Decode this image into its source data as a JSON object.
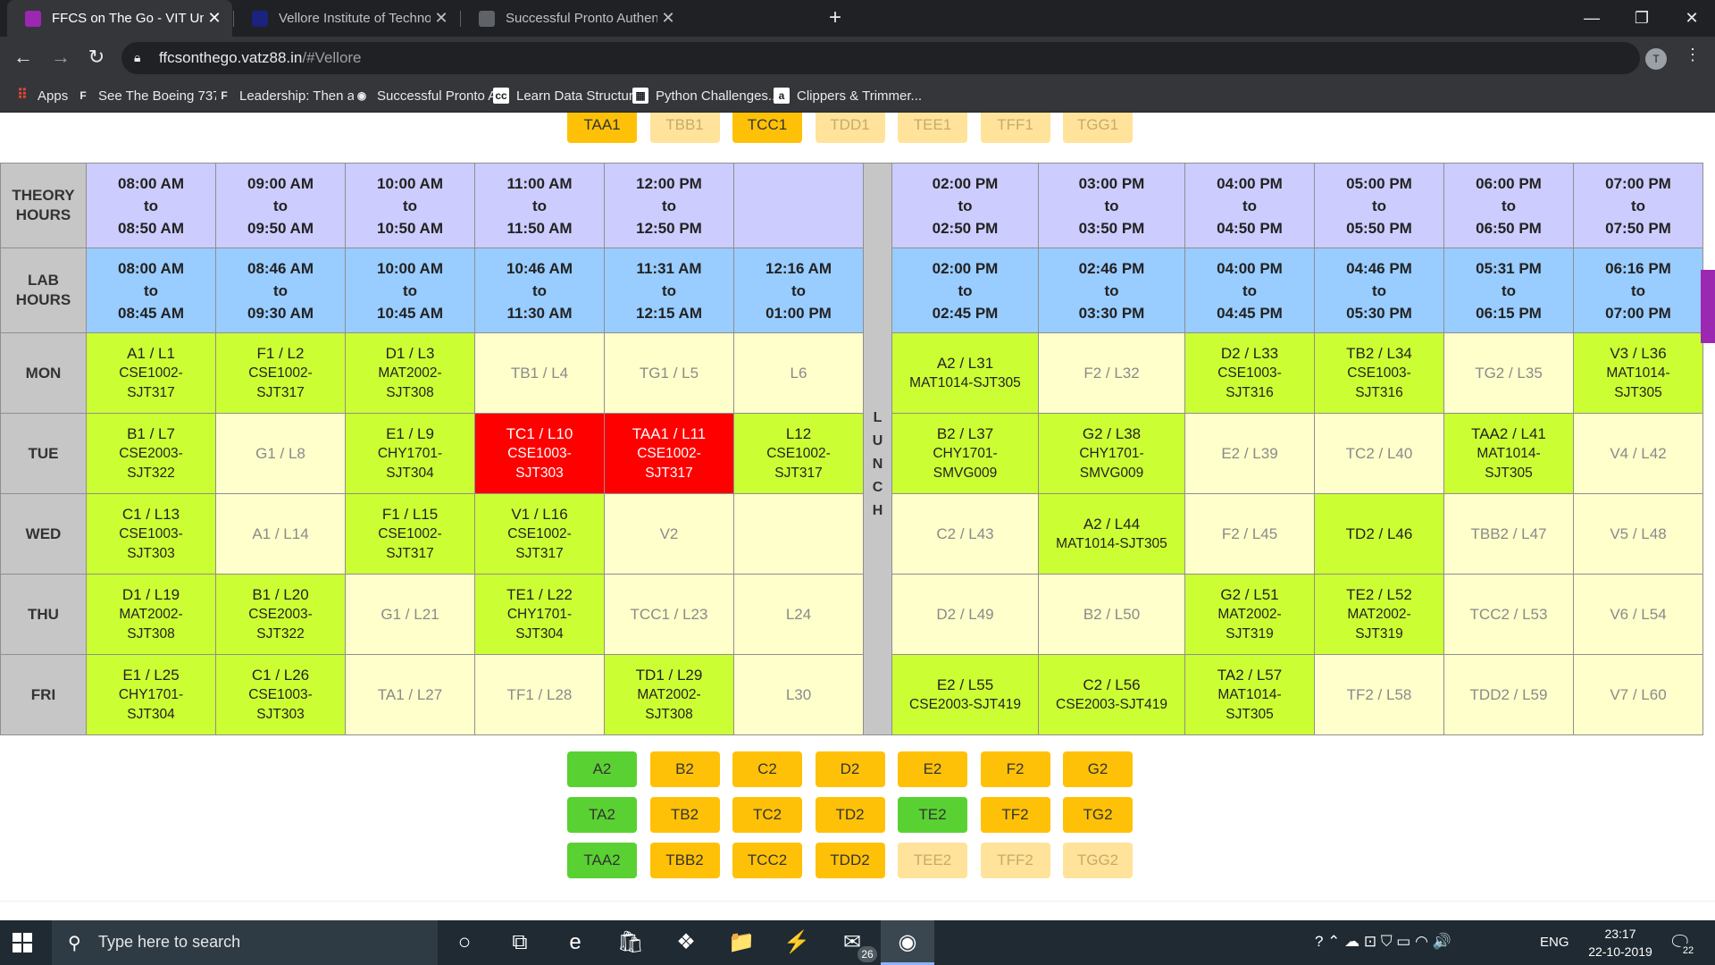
{
  "browser": {
    "tabs": [
      {
        "title": "FFCS on The Go - VIT University",
        "active": true,
        "favicon_color": "#9c27b0"
      },
      {
        "title": "Vellore Institute of Technology (V",
        "active": false,
        "favicon_color": "#1a237e"
      },
      {
        "title": "Successful Pronto Authentication",
        "active": false,
        "favicon_color": "#5f6368"
      }
    ],
    "close_glyph": "✕",
    "new_tab_glyph": "+",
    "window_controls": {
      "minimize": "—",
      "restore": "❐",
      "close": "✕"
    },
    "nav": {
      "back": "←",
      "forward": "→",
      "reload": "↻"
    },
    "url_host": "ffcsonthego.vatz88.in",
    "url_path": "/#Vellore",
    "profile_initial": "T",
    "bookmarks": [
      {
        "label": "Apps",
        "icon": "apps-grid-icon",
        "icon_text": "⠿",
        "color": "#ea4335"
      },
      {
        "label": "See The Boeing 737...",
        "icon": "f-icon",
        "icon_text": "F",
        "color": "#35363a"
      },
      {
        "label": "Leadership: Then a...",
        "icon": "f-icon",
        "icon_text": "F",
        "color": "#35363a"
      },
      {
        "label": "Successful Pronto A...",
        "icon": "globe-icon",
        "icon_text": "◉",
        "color": "#35363a"
      },
      {
        "label": "Learn Data Structur...",
        "icon": "cc-icon",
        "icon_text": "cc",
        "color": "#ffffff"
      },
      {
        "label": "Python Challenges...",
        "icon": "python-challenges-icon",
        "icon_text": "▦",
        "color": "#ffffff"
      },
      {
        "label": "Clippers & Trimmer...",
        "icon": "amazon-icon",
        "icon_text": "a",
        "color": "#ffffff"
      }
    ]
  },
  "top_slots": [
    {
      "label": "TAA1",
      "state": "orange"
    },
    {
      "label": "TBB1",
      "state": "pale"
    },
    {
      "label": "TCC1",
      "state": "orange"
    },
    {
      "label": "TDD1",
      "state": "pale"
    },
    {
      "label": "TEE1",
      "state": "pale"
    },
    {
      "label": "TFF1",
      "state": "pale"
    },
    {
      "label": "TGG1",
      "state": "pale"
    }
  ],
  "timetable": {
    "theory_label": [
      "THEORY",
      "HOURS"
    ],
    "lab_label": [
      "LAB",
      "HOURS"
    ],
    "lunch_letters": [
      "L",
      "U",
      "N",
      "C",
      "H"
    ],
    "to_word": "to",
    "theory_hours": [
      [
        "08:00 AM",
        "08:50 AM"
      ],
      [
        "09:00 AM",
        "09:50 AM"
      ],
      [
        "10:00 AM",
        "10:50 AM"
      ],
      [
        "11:00 AM",
        "11:50 AM"
      ],
      [
        "12:00 PM",
        "12:50 PM"
      ],
      null,
      [
        "02:00 PM",
        "02:50 PM"
      ],
      [
        "03:00 PM",
        "03:50 PM"
      ],
      [
        "04:00 PM",
        "04:50 PM"
      ],
      [
        "05:00 PM",
        "05:50 PM"
      ],
      [
        "06:00 PM",
        "06:50 PM"
      ],
      [
        "07:00 PM",
        "07:50 PM"
      ]
    ],
    "lab_hours": [
      [
        "08:00 AM",
        "08:45 AM"
      ],
      [
        "08:46 AM",
        "09:30 AM"
      ],
      [
        "10:00 AM",
        "10:45 AM"
      ],
      [
        "10:46 AM",
        "11:30 AM"
      ],
      [
        "11:31 AM",
        "12:15 AM"
      ],
      [
        "12:16 AM",
        "01:00 PM"
      ],
      [
        "02:00 PM",
        "02:45 PM"
      ],
      [
        "02:46 PM",
        "03:30 PM"
      ],
      [
        "04:00 PM",
        "04:45 PM"
      ],
      [
        "04:46 PM",
        "05:30 PM"
      ],
      [
        "05:31 PM",
        "06:15 PM"
      ],
      [
        "06:16 PM",
        "07:00 PM"
      ]
    ],
    "days": [
      {
        "day": "MON",
        "cells": [
          {
            "label": "A1 / L1",
            "sub": [
              "CSE1002-",
              "SJT317"
            ],
            "state": "green"
          },
          {
            "label": "F1 / L2",
            "sub": [
              "CSE1002-",
              "SJT317"
            ],
            "state": "green"
          },
          {
            "label": "D1 / L3",
            "sub": [
              "MAT2002-",
              "SJT308"
            ],
            "state": "green"
          },
          {
            "label": "TB1 / L4",
            "sub": [],
            "state": "pale"
          },
          {
            "label": "TG1 / L5",
            "sub": [],
            "state": "pale"
          },
          {
            "label": "L6",
            "sub": [],
            "state": "pale"
          },
          {
            "label": "A2 / L31",
            "sub": [
              "MAT1014-SJT305"
            ],
            "state": "green"
          },
          {
            "label": "F2 / L32",
            "sub": [],
            "state": "pale"
          },
          {
            "label": "D2 / L33",
            "sub": [
              "CSE1003-",
              "SJT316"
            ],
            "state": "green"
          },
          {
            "label": "TB2 / L34",
            "sub": [
              "CSE1003-",
              "SJT316"
            ],
            "state": "green"
          },
          {
            "label": "TG2 / L35",
            "sub": [],
            "state": "pale"
          },
          {
            "label": "V3 / L36",
            "sub": [
              "MAT1014-",
              "SJT305"
            ],
            "state": "green"
          }
        ]
      },
      {
        "day": "TUE",
        "cells": [
          {
            "label": "B1 / L7",
            "sub": [
              "CSE2003-",
              "SJT322"
            ],
            "state": "green"
          },
          {
            "label": "G1 / L8",
            "sub": [],
            "state": "pale"
          },
          {
            "label": "E1 / L9",
            "sub": [
              "CHY1701-",
              "SJT304"
            ],
            "state": "green"
          },
          {
            "label": "TC1 / L10",
            "sub": [
              "CSE1003-",
              "SJT303"
            ],
            "state": "red"
          },
          {
            "label": "TAA1 / L11",
            "sub": [
              "CSE1002-",
              "SJT317"
            ],
            "state": "red"
          },
          {
            "label": "L12",
            "sub": [
              "CSE1002-",
              "SJT317"
            ],
            "state": "green"
          },
          {
            "label": "B2 / L37",
            "sub": [
              "CHY1701-",
              "SMVG009"
            ],
            "state": "green"
          },
          {
            "label": "G2 / L38",
            "sub": [
              "CHY1701-",
              "SMVG009"
            ],
            "state": "green"
          },
          {
            "label": "E2 / L39",
            "sub": [],
            "state": "pale"
          },
          {
            "label": "TC2 / L40",
            "sub": [],
            "state": "pale"
          },
          {
            "label": "TAA2 / L41",
            "sub": [
              "MAT1014-",
              "SJT305"
            ],
            "state": "green"
          },
          {
            "label": "V4 / L42",
            "sub": [],
            "state": "pale"
          }
        ]
      },
      {
        "day": "WED",
        "cells": [
          {
            "label": "C1 / L13",
            "sub": [
              "CSE1003-",
              "SJT303"
            ],
            "state": "green"
          },
          {
            "label": "A1 / L14",
            "sub": [],
            "state": "pale"
          },
          {
            "label": "F1 / L15",
            "sub": [
              "CSE1002-",
              "SJT317"
            ],
            "state": "green"
          },
          {
            "label": "V1 / L16",
            "sub": [
              "CSE1002-",
              "SJT317"
            ],
            "state": "green"
          },
          {
            "label": "V2",
            "sub": [],
            "state": "pale"
          },
          {
            "label": "",
            "sub": [],
            "state": "pale"
          },
          {
            "label": "C2 / L43",
            "sub": [],
            "state": "pale"
          },
          {
            "label": "A2 / L44",
            "sub": [
              "MAT1014-SJT305"
            ],
            "state": "green"
          },
          {
            "label": "F2 / L45",
            "sub": [],
            "state": "pale"
          },
          {
            "label": "TD2 / L46",
            "sub": [],
            "state": "green"
          },
          {
            "label": "TBB2 / L47",
            "sub": [],
            "state": "pale"
          },
          {
            "label": "V5 / L48",
            "sub": [],
            "state": "pale"
          }
        ]
      },
      {
        "day": "THU",
        "cells": [
          {
            "label": "D1 / L19",
            "sub": [
              "MAT2002-",
              "SJT308"
            ],
            "state": "green"
          },
          {
            "label": "B1 / L20",
            "sub": [
              "CSE2003-",
              "SJT322"
            ],
            "state": "green"
          },
          {
            "label": "G1 / L21",
            "sub": [],
            "state": "pale"
          },
          {
            "label": "TE1 / L22",
            "sub": [
              "CHY1701-",
              "SJT304"
            ],
            "state": "green"
          },
          {
            "label": "TCC1 / L23",
            "sub": [],
            "state": "pale"
          },
          {
            "label": "L24",
            "sub": [],
            "state": "pale"
          },
          {
            "label": "D2 / L49",
            "sub": [],
            "state": "pale"
          },
          {
            "label": "B2 / L50",
            "sub": [],
            "state": "pale"
          },
          {
            "label": "G2 / L51",
            "sub": [
              "MAT2002-",
              "SJT319"
            ],
            "state": "green"
          },
          {
            "label": "TE2 / L52",
            "sub": [
              "MAT2002-",
              "SJT319"
            ],
            "state": "green"
          },
          {
            "label": "TCC2 / L53",
            "sub": [],
            "state": "pale"
          },
          {
            "label": "V6 / L54",
            "sub": [],
            "state": "pale"
          }
        ]
      },
      {
        "day": "FRI",
        "cells": [
          {
            "label": "E1 / L25",
            "sub": [
              "CHY1701-",
              "SJT304"
            ],
            "state": "green"
          },
          {
            "label": "C1 / L26",
            "sub": [
              "CSE1003-",
              "SJT303"
            ],
            "state": "green"
          },
          {
            "label": "TA1 / L27",
            "sub": [],
            "state": "pale"
          },
          {
            "label": "TF1 / L28",
            "sub": [],
            "state": "pale"
          },
          {
            "label": "TD1 / L29",
            "sub": [
              "MAT2002-",
              "SJT308"
            ],
            "state": "green"
          },
          {
            "label": "L30",
            "sub": [],
            "state": "pale"
          },
          {
            "label": "E2 / L55",
            "sub": [
              "CSE2003-SJT419"
            ],
            "state": "green"
          },
          {
            "label": "C2 / L56",
            "sub": [
              "CSE2003-SJT419"
            ],
            "state": "green"
          },
          {
            "label": "TA2 / L57",
            "sub": [
              "MAT1014-",
              "SJT305"
            ],
            "state": "green"
          },
          {
            "label": "TF2 / L58",
            "sub": [],
            "state": "pale"
          },
          {
            "label": "TDD2 / L59",
            "sub": [],
            "state": "pale"
          },
          {
            "label": "V7 / L60",
            "sub": [],
            "state": "pale"
          }
        ]
      }
    ]
  },
  "bottom_slots": [
    [
      {
        "label": "A2",
        "state": "green"
      },
      {
        "label": "B2",
        "state": "orange"
      },
      {
        "label": "C2",
        "state": "orange"
      },
      {
        "label": "D2",
        "state": "orange"
      },
      {
        "label": "E2",
        "state": "orange"
      },
      {
        "label": "F2",
        "state": "orange"
      },
      {
        "label": "G2",
        "state": "orange"
      }
    ],
    [
      {
        "label": "TA2",
        "state": "green"
      },
      {
        "label": "TB2",
        "state": "orange"
      },
      {
        "label": "TC2",
        "state": "orange"
      },
      {
        "label": "TD2",
        "state": "orange"
      },
      {
        "label": "TE2",
        "state": "green"
      },
      {
        "label": "TF2",
        "state": "orange"
      },
      {
        "label": "TG2",
        "state": "orange"
      }
    ],
    [
      {
        "label": "TAA2",
        "state": "green"
      },
      {
        "label": "TBB2",
        "state": "orange"
      },
      {
        "label": "TCC2",
        "state": "orange"
      },
      {
        "label": "TDD2",
        "state": "orange"
      },
      {
        "label": "TEE2",
        "state": "pale"
      },
      {
        "label": "TFF2",
        "state": "pale"
      },
      {
        "label": "TGG2",
        "state": "pale"
      }
    ]
  ],
  "taskbar": {
    "search_placeholder": "Type here to search",
    "search_glyph": "⚲",
    "apps": [
      {
        "name": "cortana-icon",
        "glyph": "○",
        "badge": ""
      },
      {
        "name": "task-view-icon",
        "glyph": "⧉",
        "badge": ""
      },
      {
        "name": "edge-icon",
        "glyph": "e",
        "badge": ""
      },
      {
        "name": "store-icon",
        "glyph": "🛍",
        "badge": ""
      },
      {
        "name": "dropbox-icon",
        "glyph": "❖",
        "badge": ""
      },
      {
        "name": "file-explorer-icon",
        "glyph": "📁",
        "badge": ""
      },
      {
        "name": "vscode-icon",
        "glyph": "⚡",
        "badge": ""
      },
      {
        "name": "mail-icon",
        "glyph": "✉",
        "badge": "26"
      },
      {
        "name": "chrome-icon",
        "glyph": "◉",
        "badge": "",
        "active": true
      }
    ],
    "tray_glyphs": "? ⌃ ☁ ⊡ ⛉ ▭ ◠ 🔊",
    "language": "ENG",
    "time": "23:17",
    "date": "22-10-2019",
    "notification_glyph": "🗨",
    "notification_count": "22"
  }
}
